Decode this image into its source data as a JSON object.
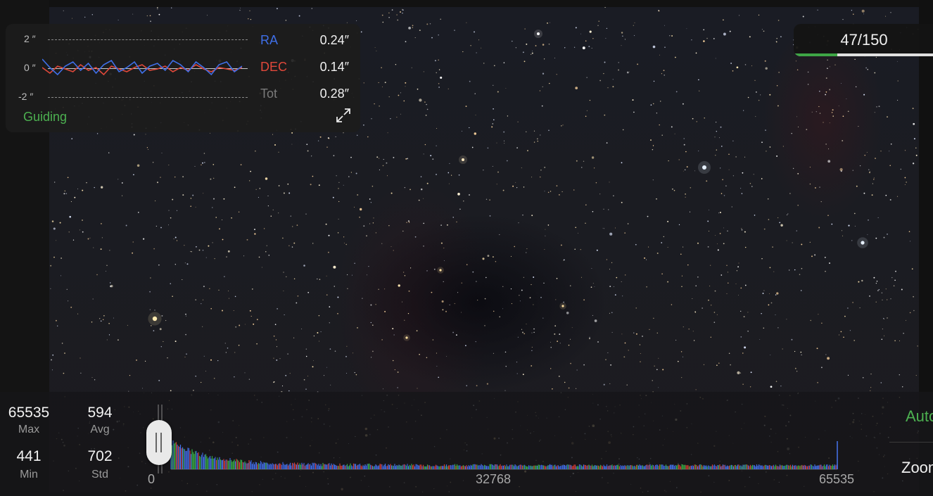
{
  "guiding": {
    "axis_top": "2 ″",
    "axis_mid": "0 ″",
    "axis_bot": "-2 ″",
    "ra_label": "RA",
    "ra_value": "0.24″",
    "dec_label": "DEC",
    "dec_value": "0.14″",
    "tot_label": "Tot",
    "tot_value": "0.28″",
    "status": "Guiding",
    "ra_series": [
      0.7,
      0.1,
      -0.4,
      0.2,
      0.5,
      -0.1,
      0.4,
      -0.3,
      0.3,
      0.6,
      -0.2,
      0.1,
      0.5,
      -0.3,
      0.2,
      0.4,
      -0.1,
      0.6,
      0.3,
      -0.2,
      0.5,
      0.1,
      -0.4,
      0.3,
      0.5,
      -0.2,
      0.2
    ],
    "dec_series": [
      0.1,
      -0.3,
      0.2,
      0.0,
      -0.2,
      0.3,
      -0.1,
      0.1,
      -0.4,
      0.2,
      0.0,
      -0.2,
      0.1,
      0.3,
      -0.1,
      0.0,
      0.2,
      -0.2,
      0.1,
      -0.1,
      0.3,
      0.0,
      -0.2,
      0.1,
      0.0,
      -0.1,
      0.1
    ],
    "colors": {
      "ra": "#3f6fe8",
      "dec": "#e0483a",
      "tot": "#7a7a7a",
      "status": "#4cb050"
    }
  },
  "frames": {
    "label": "47/150",
    "current": 47,
    "total": 150
  },
  "stats": {
    "max_value": "65535",
    "max_label": "Max",
    "avg_value": "594",
    "avg_label": "Avg",
    "min_value": "441",
    "min_label": "Min",
    "std_value": "702",
    "std_label": "Std"
  },
  "histogram": {
    "tick_start": "0",
    "tick_mid": "32768",
    "tick_end": "65535"
  },
  "side": {
    "auto_label": "Auto",
    "zoom_label": "Zoom"
  }
}
